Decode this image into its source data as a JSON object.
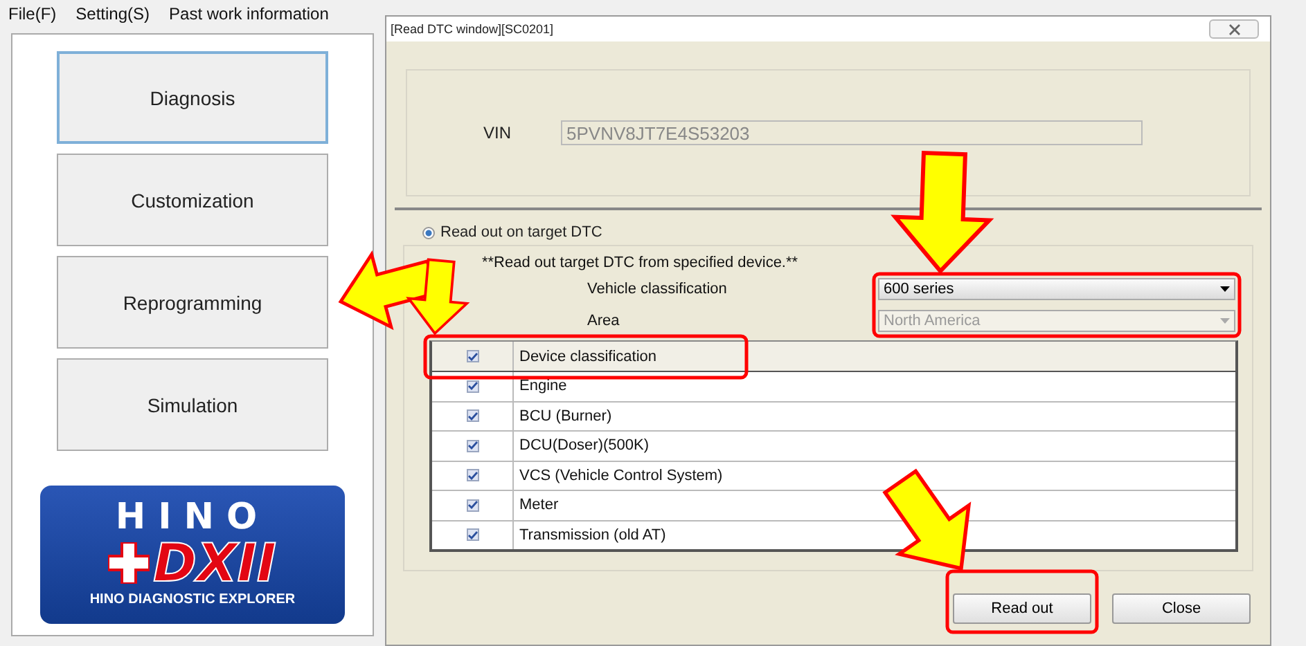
{
  "menu": [
    "File(F)",
    "Setting(S)",
    "Past work information"
  ],
  "nav_buttons": [
    {
      "label": "Diagnosis",
      "selected": true
    },
    {
      "label": "Customization",
      "selected": false
    },
    {
      "label": "Reprogramming",
      "selected": false
    },
    {
      "label": "Simulation",
      "selected": false
    }
  ],
  "logo": {
    "brand": "HINO",
    "mark": "DXII",
    "tagline": "HINO DIAGNOSTIC EXPLORER"
  },
  "dialog": {
    "title": "[Read DTC window][SC0201]",
    "vin": {
      "label": "VIN",
      "value": "5PVNV8JT7E4S53203",
      "disabled": true
    },
    "read_mode": {
      "label": "Read out on target DTC",
      "selected": true
    },
    "note": "**Read out target DTC from specified device.**",
    "fields": [
      {
        "label": "Vehicle classification",
        "value": "600 series",
        "disabled": false
      },
      {
        "label": "Area",
        "value": "North America",
        "disabled": true
      }
    ],
    "table": {
      "header": {
        "label": "Device classification",
        "checked": true
      },
      "rows": [
        {
          "label": "Engine",
          "checked": true
        },
        {
          "label": "BCU (Burner)",
          "checked": true
        },
        {
          "label": "DCU(Doser)(500K)",
          "checked": true
        },
        {
          "label": "VCS (Vehicle Control System)",
          "checked": true
        },
        {
          "label": "Meter",
          "checked": true
        },
        {
          "label": "Transmission (old AT)",
          "checked": true
        }
      ]
    },
    "buttons": [
      "Read out",
      "Close"
    ]
  }
}
